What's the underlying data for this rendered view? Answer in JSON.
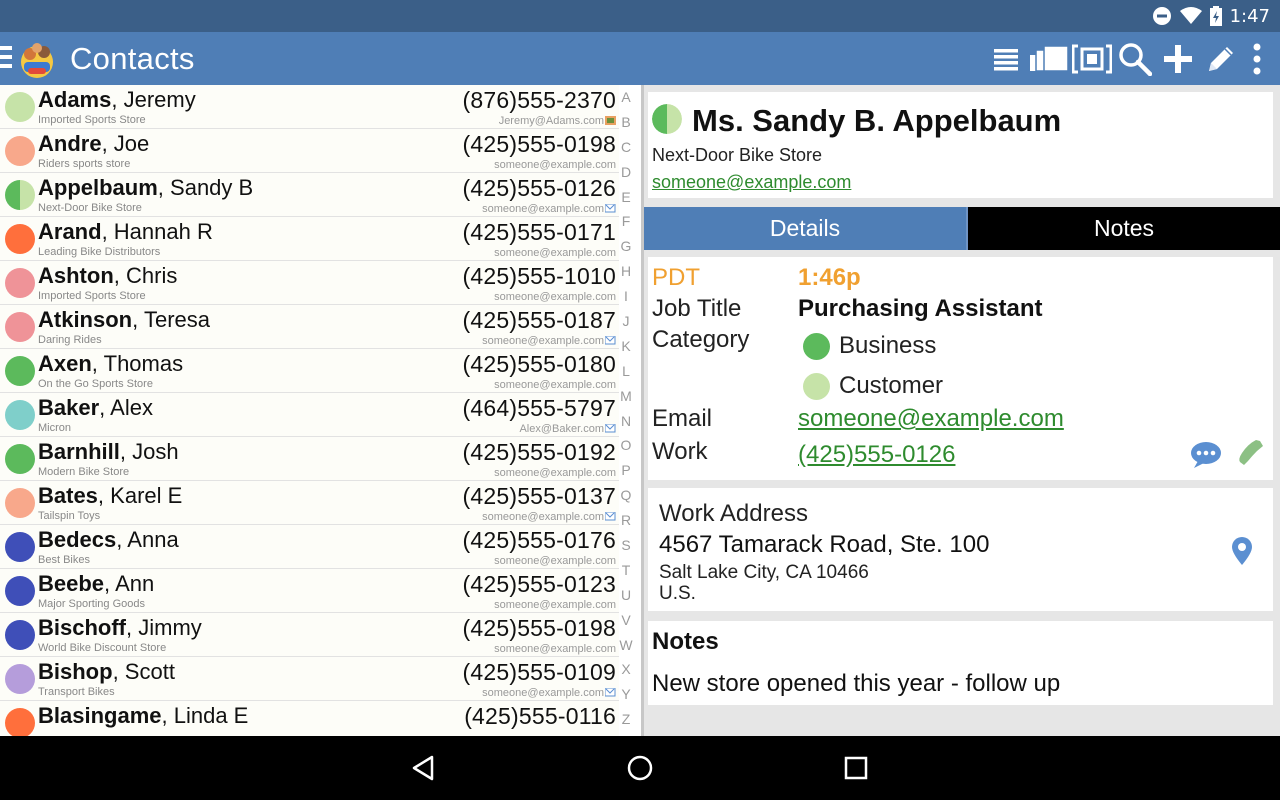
{
  "status": {
    "time": "1:47"
  },
  "app": {
    "title": "Contacts"
  },
  "contacts": [
    {
      "last": "Adams",
      "first": "Jeremy",
      "company": "Imported Sports Store",
      "phone": "(876)555-2370",
      "email": "Jeremy@Adams.com",
      "color": "#c6e3a8",
      "email_icon": "book"
    },
    {
      "last": "Andre",
      "first": "Joe",
      "company": "Riders sports store",
      "phone": "(425)555-0198",
      "email": "someone@example.com",
      "color": "#f8a88b",
      "email_icon": ""
    },
    {
      "last": "Appelbaum",
      "first": "Sandy B",
      "company": "Next-Door Bike Store",
      "phone": "(425)555-0126",
      "email": "someone@example.com",
      "color": "split",
      "email_icon": "flag"
    },
    {
      "last": "Arand",
      "first": "Hannah R",
      "company": "Leading Bike Distributors",
      "phone": "(425)555-0171",
      "email": "someone@example.com",
      "color": "#ff6f3c",
      "email_icon": ""
    },
    {
      "last": "Ashton",
      "first": "Chris",
      "company": "Imported Sports Store",
      "phone": "(425)555-1010",
      "email": "someone@example.com",
      "color": "#ef9398",
      "email_icon": ""
    },
    {
      "last": "Atkinson",
      "first": "Teresa",
      "company": "Daring Rides",
      "phone": "(425)555-0187",
      "email": "someone@example.com",
      "color": "#ef9398",
      "email_icon": "flag"
    },
    {
      "last": "Axen",
      "first": "Thomas",
      "company": "On the Go Sports Store",
      "phone": "(425)555-0180",
      "email": "someone@example.com",
      "color": "#5cba5c",
      "email_icon": ""
    },
    {
      "last": "Baker",
      "first": "Alex",
      "company": "Micron",
      "phone": "(464)555-5797",
      "email": "Alex@Baker.com",
      "color": "#7fcfca",
      "email_icon": "flag"
    },
    {
      "last": "Barnhill",
      "first": "Josh",
      "company": "Modern Bike Store",
      "phone": "(425)555-0192",
      "email": "someone@example.com",
      "color": "#5cba5c",
      "email_icon": ""
    },
    {
      "last": "Bates",
      "first": "Karel E",
      "company": "Tailspin Toys",
      "phone": "(425)555-0137",
      "email": "someone@example.com",
      "color": "#f8a88b",
      "email_icon": "flag"
    },
    {
      "last": "Bedecs",
      "first": "Anna",
      "company": "Best Bikes",
      "phone": "(425)555-0176",
      "email": "someone@example.com",
      "color": "#3f4fb8",
      "email_icon": ""
    },
    {
      "last": "Beebe",
      "first": "Ann",
      "company": "Major Sporting Goods",
      "phone": "(425)555-0123",
      "email": "someone@example.com",
      "color": "#3f4fb8",
      "email_icon": ""
    },
    {
      "last": "Bischoff",
      "first": "Jimmy",
      "company": "World Bike Discount Store",
      "phone": "(425)555-0198",
      "email": "someone@example.com",
      "color": "#3f4fb8",
      "email_icon": ""
    },
    {
      "last": "Bishop",
      "first": "Scott",
      "company": "Transport Bikes",
      "phone": "(425)555-0109",
      "email": "someone@example.com",
      "color": "#b59ddb",
      "email_icon": "flag"
    },
    {
      "last": "Blasingame",
      "first": "Linda E",
      "company": "",
      "phone": "(425)555-0116",
      "email": "",
      "color": "#ff6f3c",
      "email_icon": ""
    }
  ],
  "alphabet": [
    "A",
    "B",
    "C",
    "D",
    "E",
    "F",
    "G",
    "H",
    "I",
    "J",
    "K",
    "L",
    "M",
    "N",
    "O",
    "P",
    "Q",
    "R",
    "S",
    "T",
    "U",
    "V",
    "W",
    "X",
    "Y",
    "Z"
  ],
  "detail": {
    "name": "Ms. Sandy B. Appelbaum",
    "company": "Next-Door Bike Store",
    "email": "someone@example.com",
    "tabs": {
      "details": "Details",
      "notes": "Notes"
    },
    "tz_label": "PDT",
    "tz_time": "1:46p",
    "job_title_label": "Job Title",
    "job_title": "Purchasing Assistant",
    "category_label": "Category",
    "categories": [
      {
        "name": "Business",
        "color": "#5cba5c"
      },
      {
        "name": "Customer",
        "color": "#c6e3a8"
      }
    ],
    "email_label": "Email",
    "work_label": "Work",
    "work_phone": "(425)555-0126",
    "address": {
      "title": "Work Address",
      "street": "4567 Tamarack Road, Ste. 100",
      "city": "Salt Lake City, CA 10466",
      "country": "U.S."
    },
    "notes_title": "Notes",
    "notes_text": "New store opened this year - follow up"
  },
  "colors": {
    "appbar": "#4f7eb6",
    "statusbar": "#3b5f88",
    "link": "#2e8b2e",
    "tz": "#f0a030"
  }
}
